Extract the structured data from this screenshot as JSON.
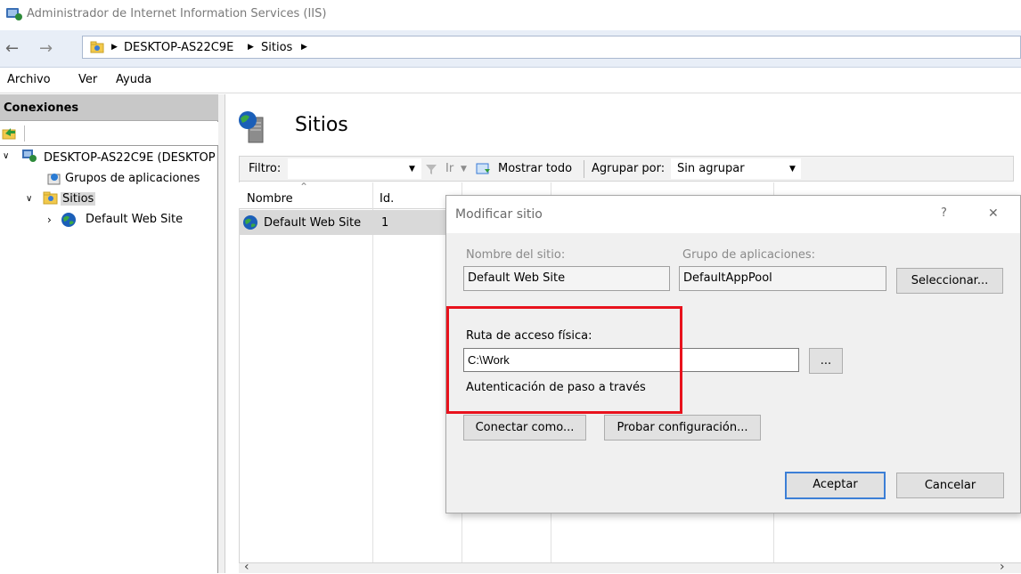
{
  "window": {
    "title": "Administrador de Internet Information Services (IIS)"
  },
  "address": {
    "nav_back": "←",
    "nav_forward": "→",
    "crumbs": [
      "DESKTOP-AS22C9E",
      "Sitios"
    ],
    "sep": "▶"
  },
  "menu": {
    "file": "Archivo",
    "view": "Ver",
    "help": "Ayuda"
  },
  "connections": {
    "header": "Conexiones",
    "server": "DESKTOP-AS22C9E (DESKTOP",
    "app_pools": "Grupos de aplicaciones",
    "sites": "Sitios",
    "default_site": "Default Web Site"
  },
  "page": {
    "title": "Sitios"
  },
  "filter": {
    "label": "Filtro:",
    "go": "Ir",
    "show_all": "Mostrar todo",
    "group_by_label": "Agrupar por:",
    "group_by_value": "Sin agrupar"
  },
  "table": {
    "columns": [
      "Nombre",
      "Id."
    ],
    "rows": [
      {
        "name": "Default Web Site",
        "id": "1"
      }
    ]
  },
  "dialog": {
    "title": "Modificar sitio",
    "help": "?",
    "close": "✕",
    "site_name_label": "Nombre del sitio:",
    "site_name_value": "Default Web Site",
    "app_pool_label": "Grupo de aplicaciones:",
    "app_pool_value": "DefaultAppPool",
    "select_button": "Seleccionar...",
    "physical_path_label": "Ruta de acceso física:",
    "physical_path_value": "C:\\Work",
    "browse_button": "...",
    "passthrough": "Autenticación de paso a través",
    "connect_as_button": "Conectar como...",
    "test_settings_button": "Probar configuración...",
    "ok_button": "Aceptar",
    "cancel_button": "Cancelar"
  },
  "colors": {
    "highlight": "#e8121d",
    "selection": "#d9d9d9",
    "primary_border": "#3c7fd6"
  }
}
